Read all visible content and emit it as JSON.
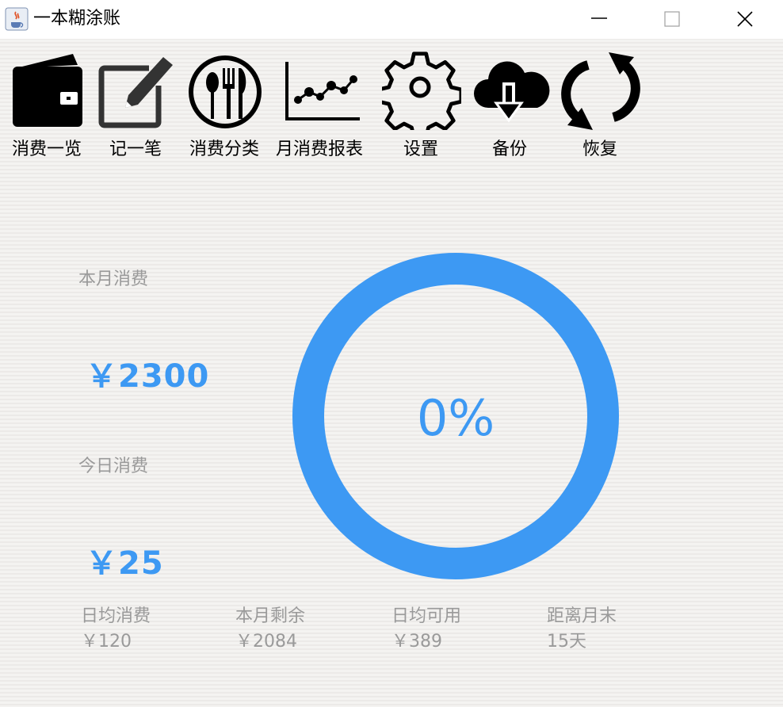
{
  "window": {
    "title": "一本糊涂账",
    "app_icon": "java-coffee-icon",
    "controls": [
      "minimize-icon",
      "maximize-icon",
      "close-icon"
    ]
  },
  "toolbar": {
    "items": [
      {
        "label": "消费一览",
        "icon": "wallet-icon"
      },
      {
        "label": "记一笔",
        "icon": "edit-icon"
      },
      {
        "label": "消费分类",
        "icon": "utensils-icon"
      },
      {
        "label": "月消费报表",
        "icon": "line-chart-icon"
      },
      {
        "label": "设置",
        "icon": "gear-icon"
      },
      {
        "label": "备份",
        "icon": "cloud-download-icon"
      },
      {
        "label": "恢复",
        "icon": "refresh-icon"
      }
    ]
  },
  "summary": {
    "month_label": "本月消费",
    "month_value": "￥2300",
    "today_label": "今日消费",
    "today_value": "￥25"
  },
  "gauge": {
    "percent_text": "0%",
    "percent": 0,
    "color": "#3d99f3"
  },
  "footer": [
    {
      "label": "日均消费",
      "value": "￥120"
    },
    {
      "label": "本月剩余",
      "value": "￥2084"
    },
    {
      "label": "日均可用",
      "value": "￥389"
    },
    {
      "label": "距离月末",
      "value": "15天"
    }
  ],
  "colors": {
    "accent": "#3d99f3",
    "muted_text": "#9a9a9a"
  }
}
